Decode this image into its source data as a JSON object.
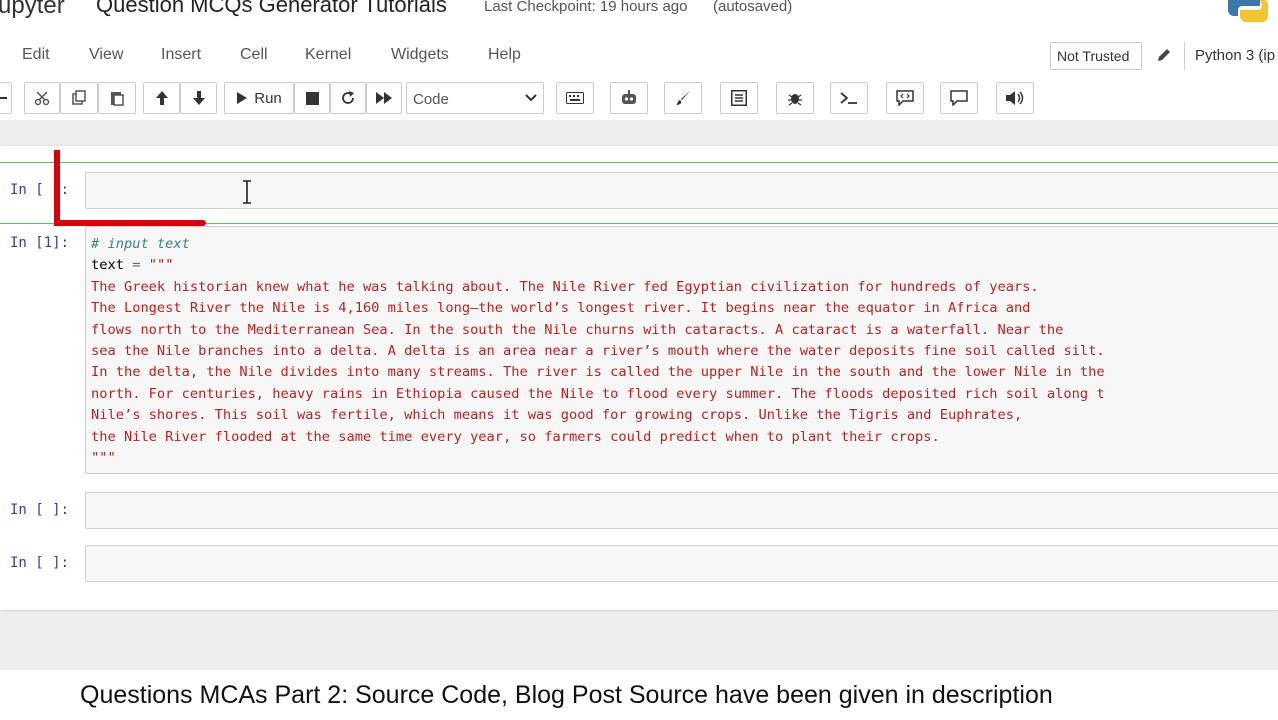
{
  "header": {
    "logo_text": "upyter",
    "notebook_title": "Question MCQs Generator Tutorials",
    "checkpoint": "Last Checkpoint: 19 hours ago",
    "autosaved": "(autosaved)"
  },
  "menu": {
    "items": [
      "Edit",
      "View",
      "Insert",
      "Cell",
      "Kernel",
      "Widgets",
      "Help"
    ],
    "trust_status": "Not Trusted",
    "kernel": "Python 3 (ip"
  },
  "toolbar": {
    "run_label": "Run",
    "cell_type": "Code"
  },
  "cells": [
    {
      "prompt": "In [ ]:",
      "selected": true,
      "source": ""
    },
    {
      "prompt": "In [1]:",
      "selected": false
    },
    {
      "prompt": "In [ ]:",
      "selected": false,
      "source": ""
    },
    {
      "prompt": "In [ ]:",
      "selected": false,
      "source": ""
    }
  ],
  "code_cell": {
    "comment": "# input text",
    "assign_var": "text",
    "assign_op": "=",
    "open_quote": "\"\"\"",
    "lines": [
      "The Greek historian knew what he was talking about. The Nile River fed Egyptian civilization for hundreds of years.",
      "The Longest River the Nile is 4,160 miles long—the world’s longest river. It begins near the equator in Africa and",
      "flows north to the Mediterranean Sea. In the south the Nile churns with cataracts. A cataract is a waterfall. Near the",
      "sea the Nile branches into a delta. A delta is an area near a river’s mouth where the water deposits fine soil called silt.",
      "In the delta, the Nile divides into many streams. The river is called the upper Nile in the south and the lower Nile in the",
      "north. For centuries, heavy rains in Ethiopia caused the Nile to flood every summer. The floods deposited rich soil along t",
      "Nile’s shores. This soil was fertile, which means it was good for growing crops. Unlike the Tigris and Euphrates,",
      "the Nile River flooded at the same time every year, so farmers could predict when to plant their crops."
    ],
    "close_quote": "\"\"\""
  },
  "caption": "Questions MCAs Part 2: Source Code, Blog Post Source have been given in description",
  "colors": {
    "prompt": "#303f9f",
    "string": "#ba2121",
    "comment": "#408080",
    "selected_border": "#66bb6a",
    "annotation_red": "#d9000d"
  }
}
